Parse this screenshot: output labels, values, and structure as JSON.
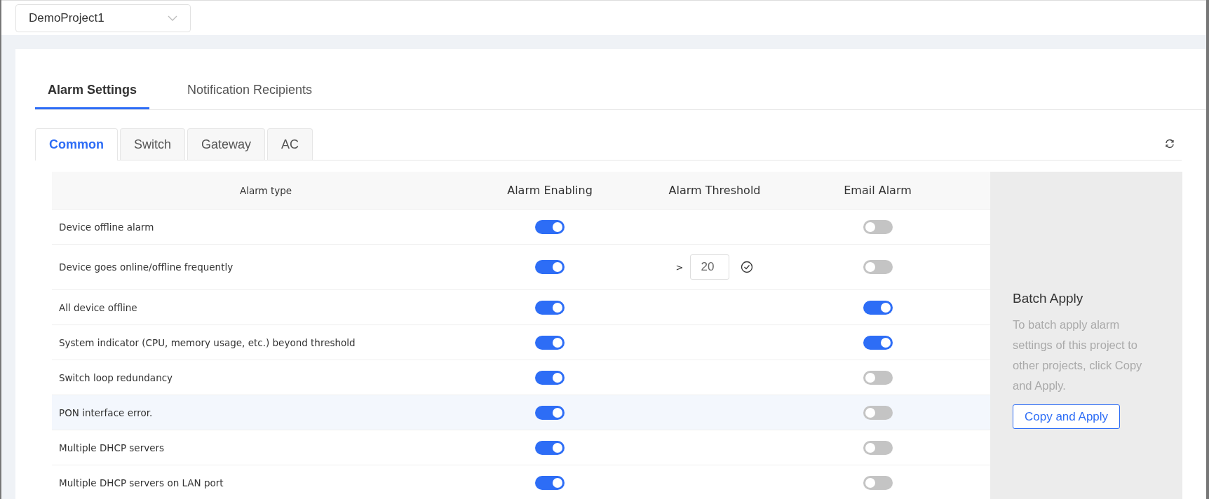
{
  "project_select": {
    "value": "DemoProject1"
  },
  "tabs": [
    {
      "label": "Alarm Settings",
      "selected": true
    },
    {
      "label": "Notification Recipients",
      "selected": false
    }
  ],
  "subtabs": [
    {
      "label": "Common",
      "selected": true
    },
    {
      "label": "Switch",
      "selected": false
    },
    {
      "label": "Gateway",
      "selected": false
    },
    {
      "label": "AC",
      "selected": false
    }
  ],
  "table": {
    "columns": [
      "Alarm type",
      "Alarm Enabling",
      "Alarm Threshold",
      "Email Alarm"
    ],
    "rows": [
      {
        "type": "Device offline alarm",
        "enabled": true,
        "email": false,
        "highlighted": false
      },
      {
        "type": "Device goes online/offline frequently",
        "enabled": true,
        "threshold": {
          "prefix": ">",
          "value": "20"
        },
        "email": false,
        "highlighted": false
      },
      {
        "type": "All device offline",
        "enabled": true,
        "email": true,
        "highlighted": false
      },
      {
        "type": "System indicator (CPU, memory usage, etc.) beyond threshold",
        "enabled": true,
        "email": true,
        "highlighted": false
      },
      {
        "type": "Switch loop redundancy",
        "enabled": true,
        "email": false,
        "highlighted": false
      },
      {
        "type": "PON interface error.",
        "enabled": true,
        "email": false,
        "highlighted": true
      },
      {
        "type": "Multiple DHCP servers",
        "enabled": true,
        "email": false,
        "highlighted": false
      },
      {
        "type": "Multiple DHCP servers on LAN port",
        "enabled": true,
        "email": false,
        "highlighted": false
      }
    ]
  },
  "batch_apply": {
    "title": "Batch Apply",
    "description": "To batch apply alarm settings of this project to other projects, click Copy and Apply.",
    "button": "Copy and Apply"
  }
}
